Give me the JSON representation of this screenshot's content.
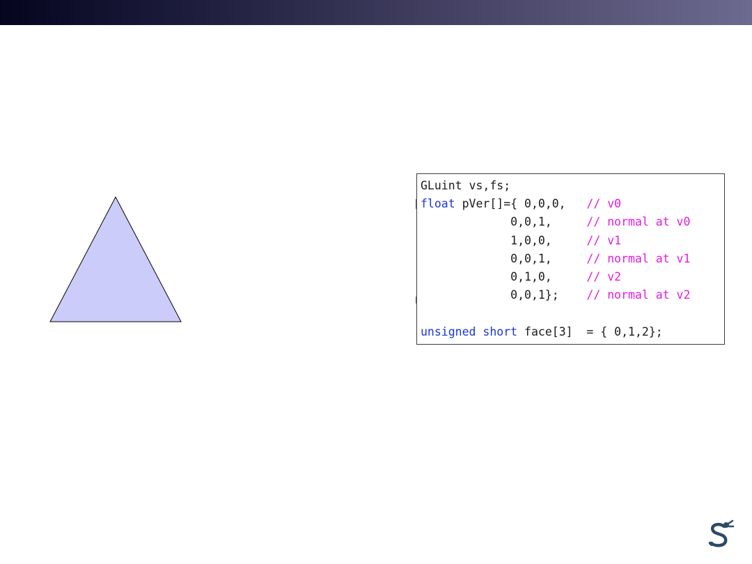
{
  "code": {
    "lines": [
      [
        {
          "t": "GLuint vs,fs;",
          "c": "plain"
        }
      ],
      [
        {
          "t": "float",
          "c": "type"
        },
        {
          "t": " pVer[]={ 0,0,0,   ",
          "c": "plain"
        },
        {
          "t": "// v0",
          "c": "comment"
        }
      ],
      [
        {
          "t": "             0,0,1,     ",
          "c": "plain"
        },
        {
          "t": "// normal at v0",
          "c": "comment"
        }
      ],
      [
        {
          "t": "             1,0,0,     ",
          "c": "plain"
        },
        {
          "t": "// v1",
          "c": "comment"
        }
      ],
      [
        {
          "t": "             0,0,1,     ",
          "c": "plain"
        },
        {
          "t": "// normal at v1",
          "c": "comment"
        }
      ],
      [
        {
          "t": "             0,1,0,     ",
          "c": "plain"
        },
        {
          "t": "// v2",
          "c": "comment"
        }
      ],
      [
        {
          "t": "             0,0,1};    ",
          "c": "plain"
        },
        {
          "t": "// normal at v2",
          "c": "comment"
        }
      ],
      [],
      [
        {
          "t": "unsigned",
          "c": "type"
        },
        {
          "t": " ",
          "c": "plain"
        },
        {
          "t": "short",
          "c": "type"
        },
        {
          "t": " face[3]  = { 0,1,2};",
          "c": "plain"
        }
      ]
    ]
  },
  "colors": {
    "triangle_fill": "#ccccfa",
    "keyword": "#1a36d8",
    "comment": "#e11ce0"
  },
  "logo": {
    "icon": "robot-arm-logo-icon"
  }
}
